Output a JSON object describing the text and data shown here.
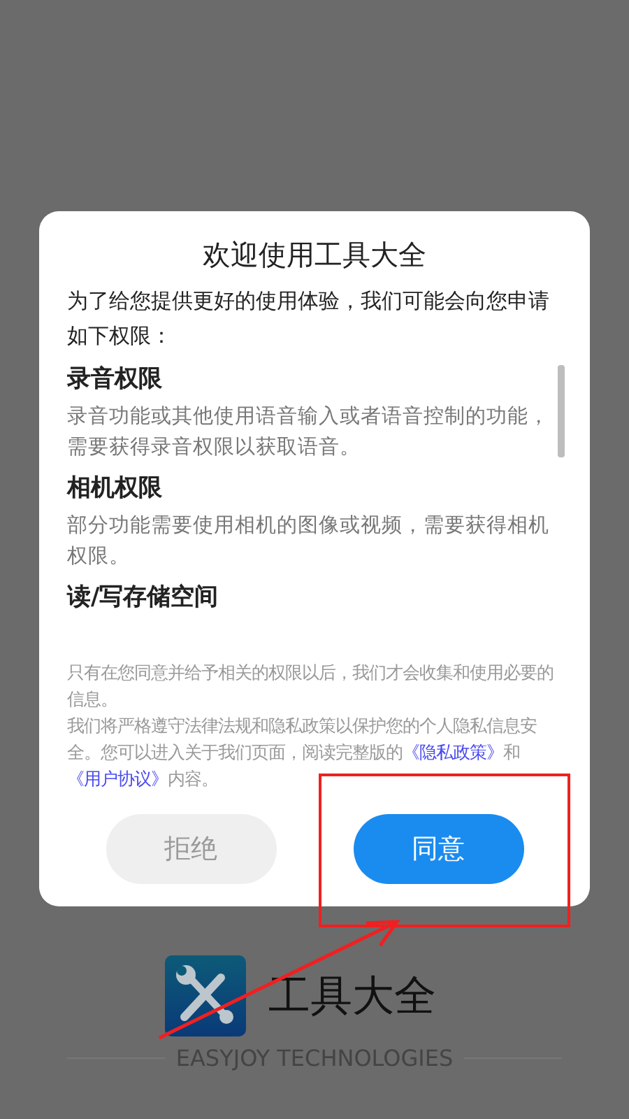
{
  "dialog": {
    "title": "欢迎使用工具大全",
    "intro": "为了给您提供更好的使用体验，我们可能会向您申请如下权限：",
    "permissions": [
      {
        "title": "录音权限",
        "description": "录音功能或其他使用语音输入或者语音控制的功能，需要获得录音权限以获取语音。"
      },
      {
        "title": "相机权限",
        "description": "部分功能需要使用相机的图像或视频，需要获得相机权限。"
      },
      {
        "title": "读/写存储空间"
      }
    ],
    "notes": [
      {
        "parts": [
          {
            "kind": "text",
            "text": "只有在您同意并给予相关的权限以后，我们才会收集和使用必要的信息。"
          }
        ]
      },
      {
        "parts": [
          {
            "kind": "text",
            "text": "我们将严格遵守法律法规和隐私政策以保护您的个人隐私信息安全。您可以进入关于我们页面，阅读完整版的"
          },
          {
            "kind": "link",
            "text": "《隐私政策》"
          },
          {
            "kind": "text",
            "text": "和"
          },
          {
            "kind": "link",
            "text": "《用户协议》"
          },
          {
            "kind": "text",
            "text": "内容。"
          }
        ]
      }
    ],
    "buttons": [
      {
        "label": "拒绝",
        "disabled": true
      },
      {
        "label": "同意",
        "disabled": false
      }
    ]
  },
  "splash": {
    "app_name": "工具大全",
    "company": "EASYJOY TECHNOLOGIES"
  },
  "annotation": {
    "highlight_box": true,
    "arrow": true
  }
}
